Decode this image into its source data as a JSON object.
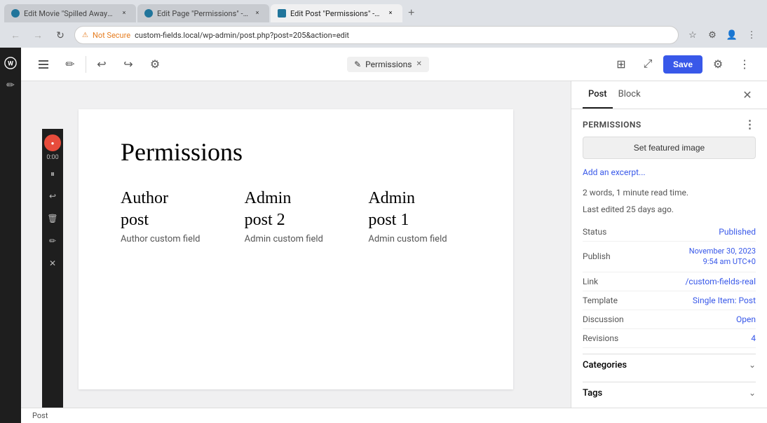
{
  "browser": {
    "tabs": [
      {
        "id": "tab1",
        "label": "Edit Movie \"Spilled Away\" - ...",
        "active": false,
        "favicon": "wp"
      },
      {
        "id": "tab2",
        "label": "Edit Page \"Permissions\" - cu...",
        "active": false,
        "favicon": "wp"
      },
      {
        "id": "tab3",
        "label": "Edit Post \"Permissions\" - cu...",
        "active": true,
        "favicon": "edit"
      }
    ],
    "address": "custom-fields.local/wp-admin/post.php?post=205&action=edit",
    "secure_warning": "Not Secure"
  },
  "editor_toolbar": {
    "save_label": "Save",
    "preview_label": "Permissions",
    "preview_close": "✕"
  },
  "page": {
    "title": "Permissions",
    "columns": [
      {
        "heading_line1": "Author",
        "heading_line2": "post",
        "field_label": "Author custom field"
      },
      {
        "heading_line1": "Admin",
        "heading_line2": "post 2",
        "field_label": "Admin custom field"
      },
      {
        "heading_line1": "Admin",
        "heading_line2": "post 1",
        "field_label": "Admin custom field"
      }
    ]
  },
  "right_panel": {
    "tab_post": "Post",
    "tab_block": "Block",
    "section_title": "Permissions",
    "featured_image_btn": "Set featured image",
    "excerpt_link": "Add an excerpt...",
    "word_count_text": "2 words, 1 minute read time.",
    "last_edited_text": "Last edited 25 days ago.",
    "rows": [
      {
        "label": "Status",
        "value": "Published",
        "link": true
      },
      {
        "label": "Publish",
        "value": "November 30, 2023\n9:54 am UTC+0",
        "link": true
      },
      {
        "label": "Link",
        "value": "/custom-fields-real",
        "link": true
      },
      {
        "label": "Template",
        "value": "Single Item: Post",
        "link": true
      },
      {
        "label": "Discussion",
        "value": "Open",
        "link": true
      },
      {
        "label": "Revisions",
        "value": "4",
        "link": true
      }
    ],
    "categories_label": "Categories",
    "tags_label": "Tags"
  },
  "status_bar": {
    "text": "Post"
  },
  "wp_sidebar": {
    "icons": [
      "☰",
      "✏",
      "↩",
      "↺",
      "🗑",
      "✏",
      "✕"
    ]
  },
  "recording": {
    "time": "0:00",
    "icons": [
      "⏸",
      "↩",
      "🗑",
      "✏",
      "✕"
    ]
  }
}
